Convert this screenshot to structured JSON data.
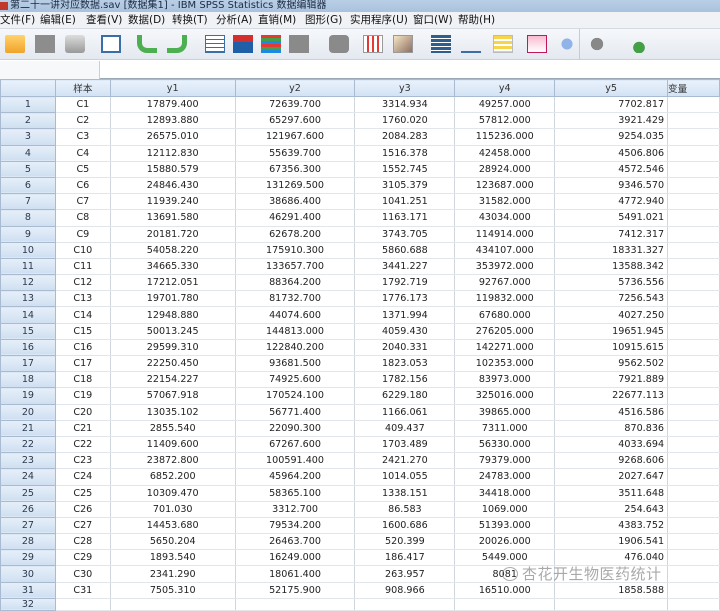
{
  "window": {
    "title": "第二十一讲对应数据.sav [数据集1] - IBM SPSS Statistics 数据编辑器"
  },
  "menu": {
    "items": [
      "文件(F)",
      "编辑(E)",
      "查看(V)",
      "数据(D)",
      "转换(T)",
      "分析(A)",
      "直销(M)",
      "图形(G)",
      "实用程序(U)",
      "窗口(W)",
      "帮助(H)"
    ]
  },
  "toolbar": {
    "icons": [
      "open-folder-icon",
      "save-icon",
      "print-icon",
      "dialog-recall-icon",
      "undo-icon",
      "redo-icon",
      "goto-case-icon",
      "goto-variable-icon",
      "variables-icon",
      "run-descriptives-icon",
      "find-icon",
      "insert-cases-icon",
      "insert-variable-icon",
      "split-file-icon",
      "weight-cases-icon",
      "select-cases-icon",
      "value-labels-icon",
      "use-variable-sets-icon",
      "show-all-variables-icon",
      "spell-check-icon"
    ]
  },
  "cellbar": {
    "reference": "",
    "value": ""
  },
  "table": {
    "columns": [
      "样本",
      "y1",
      "y2",
      "y3",
      "y4",
      "y5",
      "变量"
    ],
    "rows": [
      {
        "n": "1",
        "s": "C1",
        "y1": "17879.400",
        "y2": "72639.700",
        "y3": "3314.934",
        "y4": "49257.000",
        "y5": "7702.817"
      },
      {
        "n": "2",
        "s": "C2",
        "y1": "12893.880",
        "y2": "65297.600",
        "y3": "1760.020",
        "y4": "57812.000",
        "y5": "3921.429"
      },
      {
        "n": "3",
        "s": "C3",
        "y1": "26575.010",
        "y2": "121967.600",
        "y3": "2084.283",
        "y4": "115236.000",
        "y5": "9254.035"
      },
      {
        "n": "4",
        "s": "C4",
        "y1": "12112.830",
        "y2": "55639.700",
        "y3": "1516.378",
        "y4": "42458.000",
        "y5": "4506.806"
      },
      {
        "n": "5",
        "s": "C5",
        "y1": "15880.579",
        "y2": "67356.300",
        "y3": "1552.745",
        "y4": "28924.000",
        "y5": "4572.546"
      },
      {
        "n": "6",
        "s": "C6",
        "y1": "24846.430",
        "y2": "131269.500",
        "y3": "3105.379",
        "y4": "123687.000",
        "y5": "9346.570"
      },
      {
        "n": "7",
        "s": "C7",
        "y1": "11939.240",
        "y2": "38686.400",
        "y3": "1041.251",
        "y4": "31582.000",
        "y5": "4772.940"
      },
      {
        "n": "8",
        "s": "C8",
        "y1": "13691.580",
        "y2": "46291.400",
        "y3": "1163.171",
        "y4": "43034.000",
        "y5": "5491.021"
      },
      {
        "n": "9",
        "s": "C9",
        "y1": "20181.720",
        "y2": "62678.200",
        "y3": "3743.705",
        "y4": "114914.000",
        "y5": "7412.317"
      },
      {
        "n": "10",
        "s": "C10",
        "y1": "54058.220",
        "y2": "175910.300",
        "y3": "5860.688",
        "y4": "434107.000",
        "y5": "18331.327"
      },
      {
        "n": "11",
        "s": "C11",
        "y1": "34665.330",
        "y2": "133657.700",
        "y3": "3441.227",
        "y4": "353972.000",
        "y5": "13588.342"
      },
      {
        "n": "12",
        "s": "C12",
        "y1": "17212.051",
        "y2": "88364.200",
        "y3": "1792.719",
        "y4": "92767.000",
        "y5": "5736.556"
      },
      {
        "n": "13",
        "s": "C13",
        "y1": "19701.780",
        "y2": "81732.700",
        "y3": "1776.173",
        "y4": "119832.000",
        "y5": "7256.543"
      },
      {
        "n": "14",
        "s": "C14",
        "y1": "12948.880",
        "y2": "44074.600",
        "y3": "1371.994",
        "y4": "67680.000",
        "y5": "4027.250"
      },
      {
        "n": "15",
        "s": "C15",
        "y1": "50013.245",
        "y2": "144813.000",
        "y3": "4059.430",
        "y4": "276205.000",
        "y5": "19651.945"
      },
      {
        "n": "16",
        "s": "C16",
        "y1": "29599.310",
        "y2": "122840.200",
        "y3": "2040.331",
        "y4": "142271.000",
        "y5": "10915.615"
      },
      {
        "n": "17",
        "s": "C17",
        "y1": "22250.450",
        "y2": "93681.500",
        "y3": "1823.053",
        "y4": "102353.000",
        "y5": "9562.502"
      },
      {
        "n": "18",
        "s": "C18",
        "y1": "22154.227",
        "y2": "74925.600",
        "y3": "1782.156",
        "y4": "83973.000",
        "y5": "7921.889"
      },
      {
        "n": "19",
        "s": "C19",
        "y1": "57067.918",
        "y2": "170524.100",
        "y3": "6229.180",
        "y4": "325016.000",
        "y5": "22677.113"
      },
      {
        "n": "20",
        "s": "C20",
        "y1": "13035.102",
        "y2": "56771.400",
        "y3": "1166.061",
        "y4": "39865.000",
        "y5": "4516.586"
      },
      {
        "n": "21",
        "s": "C21",
        "y1": "2855.540",
        "y2": "22090.300",
        "y3": "409.437",
        "y4": "7311.000",
        "y5": "870.836"
      },
      {
        "n": "22",
        "s": "C22",
        "y1": "11409.600",
        "y2": "67267.600",
        "y3": "1703.489",
        "y4": "56330.000",
        "y5": "4033.694"
      },
      {
        "n": "23",
        "s": "C23",
        "y1": "23872.800",
        "y2": "100591.400",
        "y3": "2421.270",
        "y4": "79379.000",
        "y5": "9268.606"
      },
      {
        "n": "24",
        "s": "C24",
        "y1": "6852.200",
        "y2": "45964.200",
        "y3": "1014.055",
        "y4": "24783.000",
        "y5": "2027.647"
      },
      {
        "n": "25",
        "s": "C25",
        "y1": "10309.470",
        "y2": "58365.100",
        "y3": "1338.151",
        "y4": "34418.000",
        "y5": "3511.648"
      },
      {
        "n": "26",
        "s": "C26",
        "y1": "701.030",
        "y2": "3312.700",
        "y3": "86.583",
        "y4": "1069.000",
        "y5": "254.643"
      },
      {
        "n": "27",
        "s": "C27",
        "y1": "14453.680",
        "y2": "79534.200",
        "y3": "1600.686",
        "y4": "51393.000",
        "y5": "4383.752"
      },
      {
        "n": "28",
        "s": "C28",
        "y1": "5650.204",
        "y2": "26463.700",
        "y3": "520.399",
        "y4": "20026.000",
        "y5": "1906.541"
      },
      {
        "n": "29",
        "s": "C29",
        "y1": "1893.540",
        "y2": "16249.000",
        "y3": "186.417",
        "y4": "5449.000",
        "y5": "476.040"
      },
      {
        "n": "30",
        "s": "C30",
        "y1": "2341.290",
        "y2": "18061.400",
        "y3": "263.957",
        "y4": "8081",
        "y5": ""
      },
      {
        "n": "31",
        "s": "C31",
        "y1": "7505.310",
        "y2": "52175.900",
        "y3": "908.966",
        "y4": "16510.000",
        "y5": "1858.588"
      },
      {
        "n": "32",
        "s": "",
        "y1": "",
        "y2": "",
        "y3": "",
        "y4": "",
        "y5": ""
      }
    ]
  },
  "watermark": {
    "text": "杏花开生物医药统计"
  }
}
